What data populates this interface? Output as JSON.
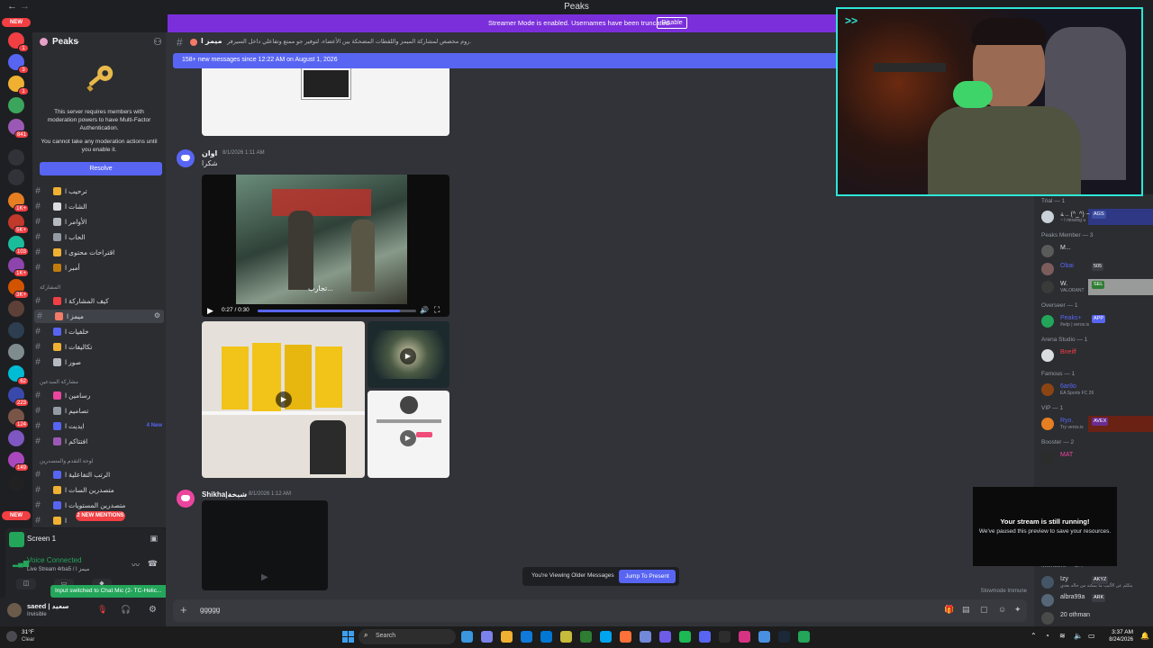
{
  "window": {
    "title": "Peaks",
    "back": "←",
    "forward": "→"
  },
  "rail": {
    "top_pill": "NEW",
    "bottom_pill": "NEW",
    "servers": [
      {
        "color": "#f23f43",
        "badge": "1"
      },
      {
        "color": "#5865f2",
        "badge": "3"
      },
      {
        "color": "#f0b132",
        "badge": "1"
      },
      {
        "color": "#3ba55d",
        "badge": ""
      },
      {
        "color": "#9b59b6",
        "badge": "841"
      },
      {
        "color": "#313338",
        "badge": ""
      },
      {
        "color": "#313338",
        "badge": ""
      },
      {
        "color": "#e67e22",
        "badge": "1K+"
      },
      {
        "color": "#c0392b",
        "badge": "5K+"
      },
      {
        "color": "#1abc9c",
        "badge": "103"
      },
      {
        "color": "#8e44ad",
        "badge": "1K+"
      },
      {
        "color": "#d35400",
        "badge": "3K+"
      },
      {
        "color": "#5d4037",
        "badge": ""
      },
      {
        "color": "#2c3e50",
        "badge": ""
      },
      {
        "color": "#7f8c8d",
        "badge": ""
      },
      {
        "color": "#00bcd4",
        "badge": "62"
      },
      {
        "color": "#3949ab",
        "badge": "223"
      },
      {
        "color": "#795548",
        "badge": "124"
      },
      {
        "color": "#7e57c2",
        "badge": ""
      },
      {
        "color": "#ab47bc",
        "badge": "149"
      },
      {
        "color": "#212121",
        "badge": ""
      }
    ]
  },
  "guild": {
    "name": "Peaks",
    "mfa_text_1": "This server requires members with moderation powers to have Multi-Factor Authentication.",
    "mfa_text_2": "You cannot take any moderation actions until you enable it.",
    "resolve_label": "Resolve"
  },
  "channels": [
    {
      "label": "ترحيب ا",
      "emoji_color": "#f0b132",
      "new": ""
    },
    {
      "label": "الشات ا",
      "emoji_color": "#dbdee1",
      "new": ""
    },
    {
      "label": "الأوامر ا",
      "emoji_color": "#b5bac1",
      "new": ""
    },
    {
      "label": "الحاب ا",
      "emoji_color": "#949ba4",
      "new": ""
    },
    {
      "label": "اقتراحات محتوى ا",
      "emoji_color": "#f0b132",
      "new": ""
    },
    {
      "label": "أمبر ا",
      "emoji_color": "#c27c0e",
      "new": ""
    },
    {
      "label": "كيف المشاركة ا",
      "emoji_color": "#f23f43",
      "new": ""
    },
    {
      "label": "ميمز ا",
      "emoji_color": "#f47b67",
      "new": ""
    },
    {
      "label": "خلفيات ا",
      "emoji_color": "#5865f2",
      "new": ""
    },
    {
      "label": "تكاليفات ا",
      "emoji_color": "#f0b132",
      "new": ""
    },
    {
      "label": "صور ا",
      "emoji_color": "#b5bac1",
      "new": ""
    },
    {
      "label": "رسامين ا",
      "emoji_color": "#eb459e",
      "new": ""
    },
    {
      "label": "تصاميم ا",
      "emoji_color": "#949ba4",
      "new": ""
    },
    {
      "label": "ايديت ا",
      "emoji_color": "#5865f2",
      "new": "4 New"
    },
    {
      "label": "افتتاكم ا",
      "emoji_color": "#9b59b6",
      "new": ""
    },
    {
      "label": "الرتب التفاعلية ا",
      "emoji_color": "#5865f2",
      "new": ""
    },
    {
      "label": "متصدرين السات ا",
      "emoji_color": "#f0b132",
      "new": ""
    },
    {
      "label": "متصدرين المستويات ا",
      "emoji_color": "#5865f2",
      "new": ""
    },
    {
      "label": "ا",
      "emoji_color": "#f0b132",
      "new": ""
    }
  ],
  "categories": [
    "المشاركة",
    "مشاركة المبدعين",
    "لوحة التقدم والمتصدرين"
  ],
  "mentions_pill": "2 NEW MENTIONS",
  "voice": {
    "screen_label": "Screen 1",
    "status": "Voice Connected",
    "sub": "Live Stream 4rba5 / ميمز ا",
    "toast": "Input switched to Chat Mic (2- TC-Helic..."
  },
  "user": {
    "name": "saeed | سعيد",
    "status": "Invisible"
  },
  "channel_header": {
    "name": "ميمز ا",
    "topic": "روم مخصص لمشاركة الميمز واللقطات المضحكة بين الأعضاء، لتوفير جو ممتع وتفاعلي داخل السيرفر."
  },
  "streamer_mode": {
    "text": "Streamer Mode is enabled. Usernames have been truncated.",
    "disable_label": "Disable"
  },
  "new_messages_bar": "158+ new messages since 12:22 AM on August 1, 2026",
  "messages": [
    {
      "author": "اوان",
      "time": "8/1/2026 1:11 AM",
      "text": "شكرا"
    },
    {
      "author": "Shikha|شيخة",
      "time": "8/1/2026 1:12 AM",
      "text": ""
    }
  ],
  "video": {
    "time": "0:27 / 0:30",
    "progress": 0.9,
    "caption": "تجارب..."
  },
  "older_bar": {
    "text": "You're Viewing Older Messages",
    "jump_label": "Jump To Present"
  },
  "slowmode": "Slowmode Immune",
  "composer": {
    "value": "ggggg"
  },
  "members": {
    "groups": [
      {
        "header": "Trial — 1",
        "rows": [
          {
            "name": "ﺔ .. (^_^) ~",
            "sub": "~ I missing u",
            "name_color": "#dbdee1",
            "tag": "AGS",
            "tag_color": "#3f4fa3",
            "av": "#c9d1d9",
            "banner": "#2f3b9a"
          }
        ]
      },
      {
        "header": "Peaks Member — 3",
        "rows": [
          {
            "name": "M...",
            "sub": "",
            "name_color": "#dbdee1",
            "tag": "",
            "tag_color": "",
            "av": "#5a5a5a",
            "banner": ""
          },
          {
            "name": "Obai",
            "sub": "",
            "name_color": "#5865f2",
            "tag": "505",
            "tag_color": "#3c3d44",
            "av": "#7d5c5c",
            "banner": ""
          },
          {
            "name": "W.",
            "sub": "VALORANT",
            "name_color": "#dbdee1",
            "tag": "SEL",
            "tag_color": "#2f7d32",
            "av": "#3a3a3a",
            "banner": "#b5b5b5"
          }
        ]
      },
      {
        "header": "Overseer — 1",
        "rows": [
          {
            "name": "Peaks+",
            "sub": "/help | veros.is",
            "name_color": "#5865f2",
            "tag": "APP",
            "tag_color": "#5865f2",
            "av": "#23a55a",
            "banner": ""
          }
        ]
      },
      {
        "header": "Arena Studio — 1",
        "rows": [
          {
            "name": "Bneiff",
            "sub": "",
            "name_color": "#f23f43",
            "tag": "",
            "tag_color": "",
            "av": "#dbdee1",
            "banner": ""
          }
        ]
      },
      {
        "header": "Famous — 1",
        "rows": [
          {
            "name": "6ar8o",
            "sub": "EA Sports FC 26",
            "name_color": "#5865f2",
            "tag": "",
            "tag_color": "",
            "av": "#8b4513",
            "banner": ""
          }
        ]
      },
      {
        "header": "VIP — 1",
        "rows": [
          {
            "name": "Ryo.",
            "sub": "Try veros.is",
            "name_color": "#5865f2",
            "tag": "AVEX",
            "tag_color": "#6a2c91",
            "av": "#e67e22",
            "banner": "#7a1f0f"
          }
        ]
      },
      {
        "header": "Booster — 2",
        "rows": [
          {
            "name": "MAT",
            "sub": "",
            "name_color": "#eb459e",
            "tag": "",
            "tag_color": "",
            "av": "#2c2c2c",
            "banner": ""
          }
        ]
      }
    ],
    "bottom_rows": [
      {
        "name": "Izy",
        "sub": "يتكلم عن الأليب ما يمكنه من حاله بعدي",
        "name_color": "#dbdee1",
        "tag": "AKYZ",
        "tag_color": "#3c3d44",
        "av": "#445566",
        "banner": ""
      },
      {
        "name": "albra99a",
        "sub": "",
        "name_color": "#dbdee1",
        "tag": "ARK",
        "tag_color": "#3c3d44",
        "av": "#556677",
        "banner": ""
      },
      {
        "name": "20 othman",
        "sub": "",
        "name_color": "#dbdee1",
        "tag": "",
        "tag_color": "",
        "av": "#4a4a4a",
        "banner": ""
      }
    ],
    "bottom_header": "Members — 2.4"
  },
  "stream_note": {
    "title": "Your stream is still running!",
    "sub": "We've paused this preview to save your resources."
  },
  "taskbar": {
    "temp": "31°F",
    "weather": "Clear",
    "search_placeholder": "Search",
    "time": "3:37 AM",
    "date": "8/24/2026",
    "apps": [
      "#3a96dd",
      "#7b83eb",
      "#f0b132",
      "#0f7ad9",
      "#0078d4",
      "#c7bb3b",
      "#2e7d32",
      "#00a4ef",
      "#ff7139",
      "#7289da",
      "#6c5ce7",
      "#1db954",
      "#5865f2",
      "#2d2d2d",
      "#d63384",
      "#4a90e2",
      "#1b2838",
      "#23a55a"
    ]
  },
  "colors": {
    "accent": "#5865f2",
    "streamer": "#7b2fdb",
    "webcam_border": "#2ee6d6",
    "danger": "#f23f43",
    "online": "#23a55a"
  }
}
